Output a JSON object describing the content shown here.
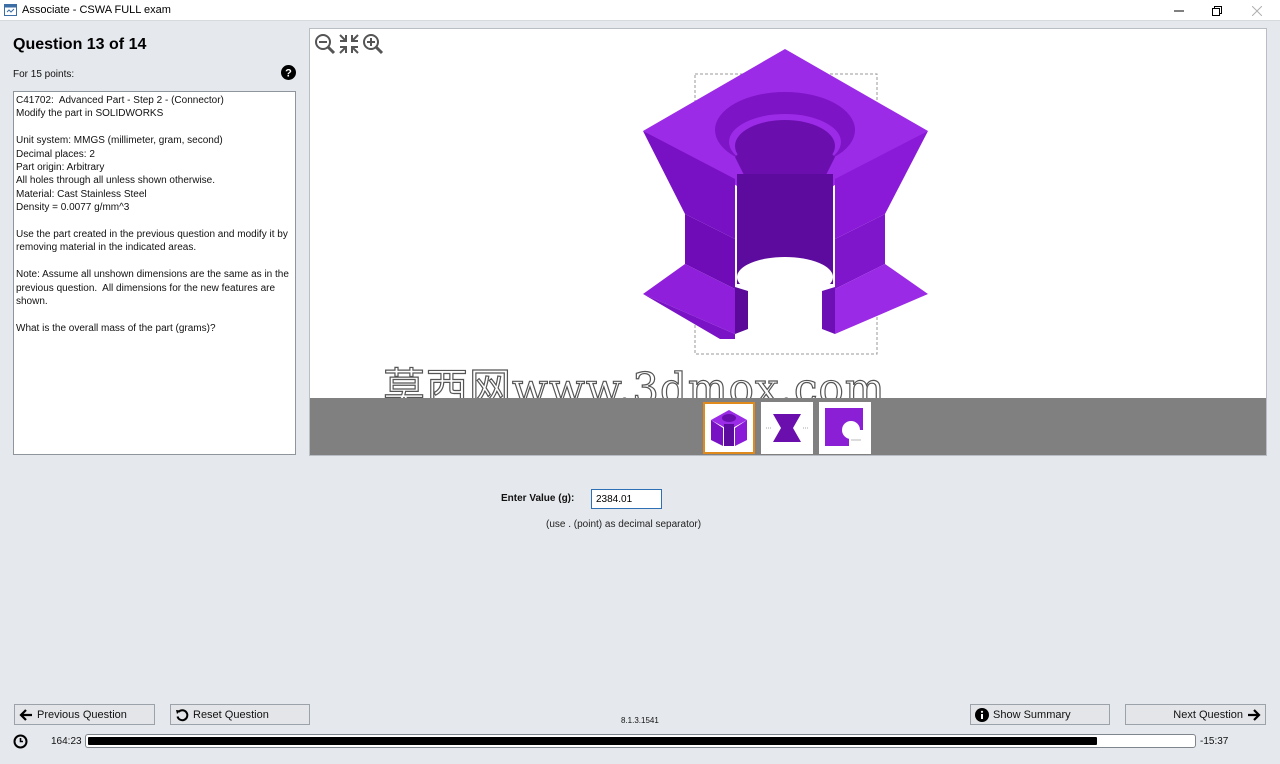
{
  "window": {
    "title": "Associate - CSWA FULL exam"
  },
  "question": {
    "heading": "Question 13 of 14",
    "points": "For 15 points:",
    "text": "C41702:  Advanced Part - Step 2 - (Connector)\nModify the part in SOLIDWORKS\n\nUnit system: MMGS (millimeter, gram, second)\nDecimal places: 2\nPart origin: Arbitrary\nAll holes through all unless shown otherwise.\nMaterial: Cast Stainless Steel\nDensity = 0.0077 g/mm^3\n\nUse the part created in the previous question and modify it by removing material in the indicated areas.\n\nNote: Assume all unshown dimensions are the same as in the previous question.  All dimensions for the new features are shown.\n\nWhat is the overall mass of the part (grams)?"
  },
  "viewer": {
    "watermark": "莫西网www.3dmox.com",
    "thumbnails": [
      {
        "name": "isometric view",
        "active": true
      },
      {
        "name": "front view",
        "active": false
      },
      {
        "name": "top view",
        "active": false
      }
    ],
    "model_color": "#8b1fd6"
  },
  "answer": {
    "label": "Enter Value (g):",
    "value": "2384.01",
    "hint": "(use . (point) as decimal separator)"
  },
  "buttons": {
    "previous": "Previous Question",
    "reset": "Reset Question",
    "summary": "Show Summary",
    "next": "Next Question"
  },
  "version": "8.1.3.1541",
  "timer": {
    "elapsed": "164:23",
    "remaining": "-15:37",
    "progress_fraction": 0.913
  },
  "colors": {
    "accent": "#e08a1e",
    "input_border": "#2f6fb4",
    "background": "#e5e8ec"
  }
}
